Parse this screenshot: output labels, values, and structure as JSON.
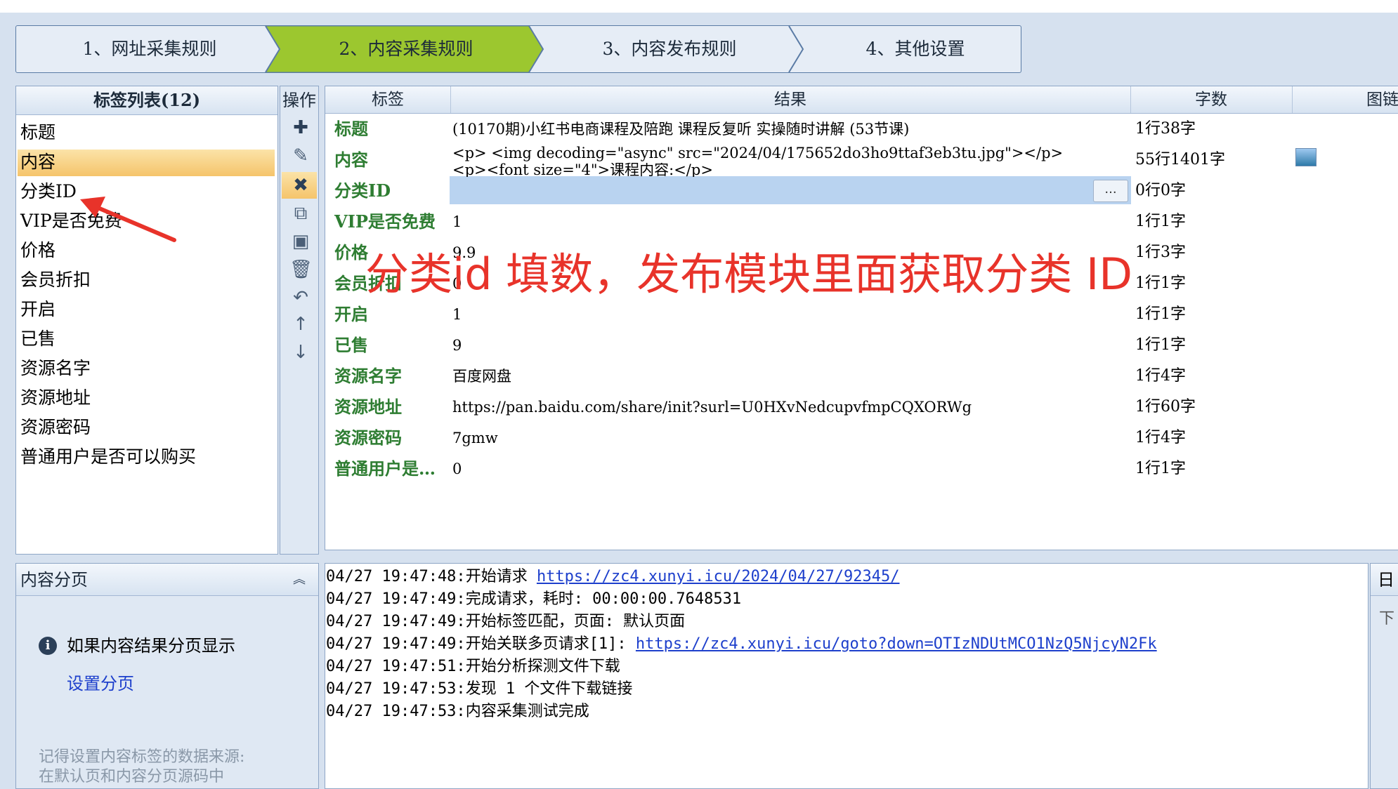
{
  "steps": [
    {
      "label": "1、网址采集规则"
    },
    {
      "label": "2、内容采集规则"
    },
    {
      "label": "3、内容发布规则"
    },
    {
      "label": "4、其他设置"
    }
  ],
  "tag_list": {
    "title": "标签列表(12)",
    "items": [
      "标题",
      "内容",
      "分类ID",
      "VIP是否免费",
      "价格",
      "会员折扣",
      "开启",
      "已售",
      "资源名字",
      "资源地址",
      "资源密码",
      "普通用户是否可以购买"
    ],
    "selected_index": 1
  },
  "toolbar": {
    "title": "操作"
  },
  "results": {
    "columns": [
      "标签",
      "结果",
      "字数",
      "图链"
    ],
    "rows": [
      {
        "label": "标题",
        "value": "(10170期)小红书电商课程及陪跑 课程反复听 实操随时讲解 (53节课)",
        "count": "1行38字"
      },
      {
        "label": "内容",
        "value": "<p> <img decoding=\"async\" src=\"2024/04/175652do3ho9ttaf3eb3tu.jpg\"></p>",
        "value2": "<p><font size=\"4\">课程内容:</p>",
        "count": "55行1401字"
      },
      {
        "label": "分类ID",
        "value": "",
        "count": "0行0字",
        "button": "..."
      },
      {
        "label": "VIP是否免费",
        "value": "1",
        "count": "1行1字"
      },
      {
        "label": "价格",
        "value": "9.9",
        "count": "1行3字"
      },
      {
        "label": "会员折扣",
        "value": "0",
        "count": "1行1字"
      },
      {
        "label": "开启",
        "value": "1",
        "count": "1行1字"
      },
      {
        "label": "已售",
        "value": "9",
        "count": "1行1字"
      },
      {
        "label": "资源名字",
        "value": "百度网盘",
        "count": "1行4字"
      },
      {
        "label": "资源地址",
        "value": "https://pan.baidu.com/share/init?surl=U0HXvNedcupvfmpCQXORWg",
        "count": "1行60字"
      },
      {
        "label": "资源密码",
        "value": "7gmw",
        "count": "1行4字"
      },
      {
        "label": "普通用户是…",
        "value": "0",
        "count": "1行1字"
      }
    ]
  },
  "annotation": {
    "text": "分类id 填数，发布模块里面获取分类 ID",
    "color": "#e8332a"
  },
  "pagination": {
    "title": "内容分页",
    "info": "如果内容结果分页显示",
    "link": "设置分页",
    "hint1": "记得设置内容标签的数据来源:",
    "hint2": "在默认页和内容分页源码中"
  },
  "log": [
    {
      "time": "04/27 19:47:48:",
      "text": "开始请求 ",
      "link": "https://zc4.xunyi.icu/2024/04/27/92345/"
    },
    {
      "time": "04/27 19:47:49:",
      "text": "完成请求，耗时: 00:00:00.7648531",
      "link": ""
    },
    {
      "time": "04/27 19:47:49:",
      "text": "开始标签匹配，页面: 默认页面",
      "link": ""
    },
    {
      "time": "04/27 19:47:49:",
      "text": "开始关联多页请求[1]: ",
      "link": "https://zc4.xunyi.icu/goto?down=OTIzNDUtMCO1NzQ5NjcyN2Fk"
    },
    {
      "time": "04/27 19:47:51:",
      "text": "开始分析探测文件下载",
      "link": ""
    },
    {
      "time": "04/27 19:47:53:",
      "text": "发现 1 个文件下载链接",
      "link": ""
    },
    {
      "time": "04/27 19:47:53:",
      "text": "内容采集测试完成",
      "link": ""
    }
  ],
  "side_panel": {
    "title": "日",
    "line": "下"
  }
}
